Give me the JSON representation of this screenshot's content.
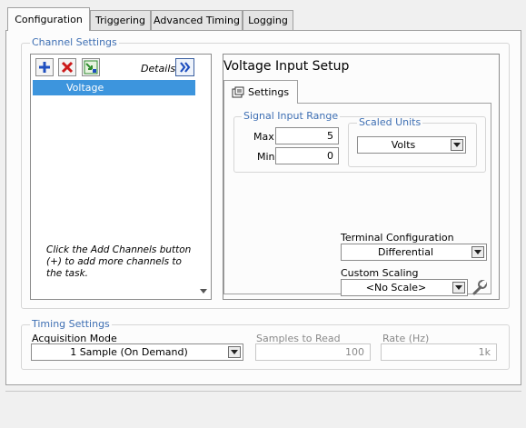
{
  "tabs": [
    "Configuration",
    "Triggering",
    "Advanced Timing",
    "Logging"
  ],
  "channel_settings": {
    "title": "Channel Settings",
    "details_label": "Details",
    "channels": [
      "Voltage"
    ],
    "hint": "Click the Add Channels button (+) to add more channels to the task."
  },
  "setup": {
    "title": "Voltage Input Setup",
    "tab_label": "Settings",
    "signal_range": {
      "title": "Signal Input Range",
      "max_label": "Max",
      "max_value": "5",
      "min_label": "Min",
      "min_value": "0"
    },
    "scaled_units": {
      "title": "Scaled Units",
      "value": "Volts"
    },
    "terminal_config": {
      "label": "Terminal Configuration",
      "value": "Differential"
    },
    "custom_scaling": {
      "label": "Custom Scaling",
      "value": "<No Scale>"
    }
  },
  "timing": {
    "title": "Timing Settings",
    "acq_mode_label": "Acquisition Mode",
    "acq_mode_value": "1 Sample (On Demand)",
    "samples_label": "Samples to Read",
    "samples_value": "100",
    "rate_label": "Rate (Hz)",
    "rate_value": "1k"
  },
  "colors": {
    "group_title": "#3e6fb3",
    "selection": "#3d95dd",
    "add": "#1f4fbf",
    "remove": "#cc1a1a"
  },
  "icons": [
    "add-icon",
    "remove-icon",
    "config-icon",
    "expand-details-icon",
    "settings-tab-icon",
    "wrench-icon",
    "chevron-down-icon"
  ]
}
